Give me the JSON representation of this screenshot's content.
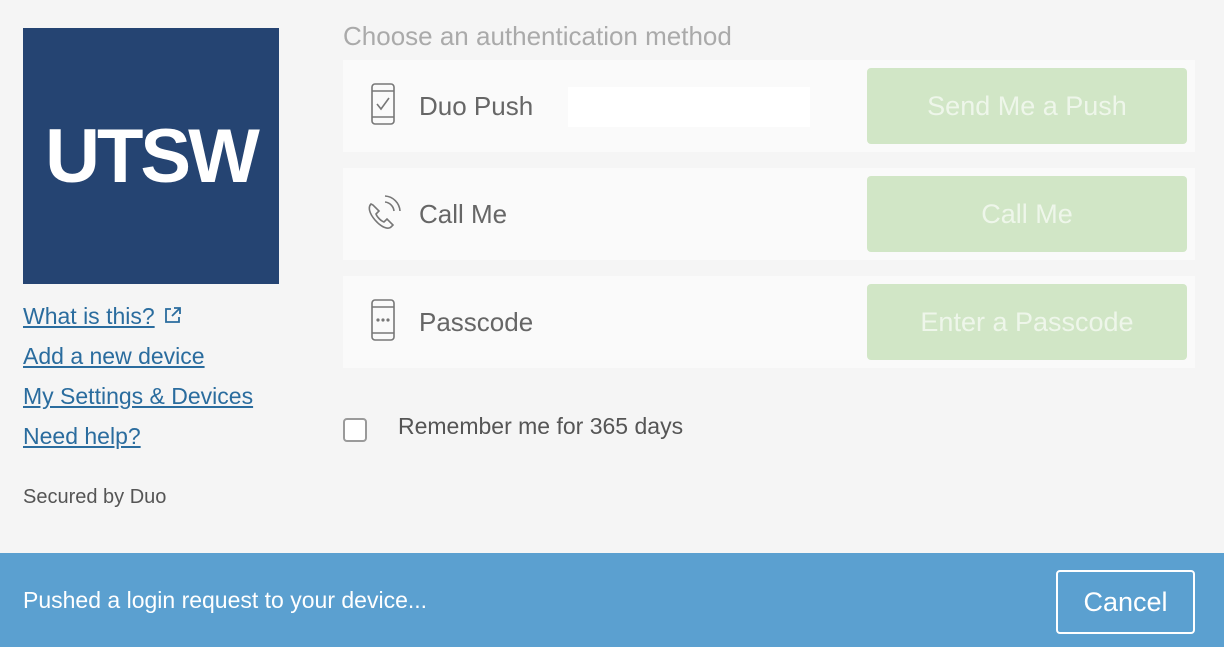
{
  "logo": {
    "text": "UTSW",
    "bg_color": "#254472"
  },
  "links": {
    "what_is_this": "What is this?",
    "add_device": "Add a new device",
    "settings": "My Settings & Devices",
    "help": "Need help?"
  },
  "secured_by": "Secured by Duo",
  "heading": "Choose an authentication method",
  "methods": [
    {
      "icon": "phone-check-icon",
      "label": "Duo Push",
      "button": "Send Me a Push"
    },
    {
      "icon": "phone-call-icon",
      "label": "Call Me",
      "button": "Call Me"
    },
    {
      "icon": "phone-passcode-icon",
      "label": "Passcode",
      "button": "Enter a Passcode"
    }
  ],
  "remember": {
    "label": "Remember me for 365 days",
    "checked": false
  },
  "status": {
    "message": "Pushed a login request to your device...",
    "cancel": "Cancel",
    "bg_color": "#5ba0d0"
  },
  "colors": {
    "accent_button": "#d1e6c6",
    "link": "#2a6c9e"
  }
}
